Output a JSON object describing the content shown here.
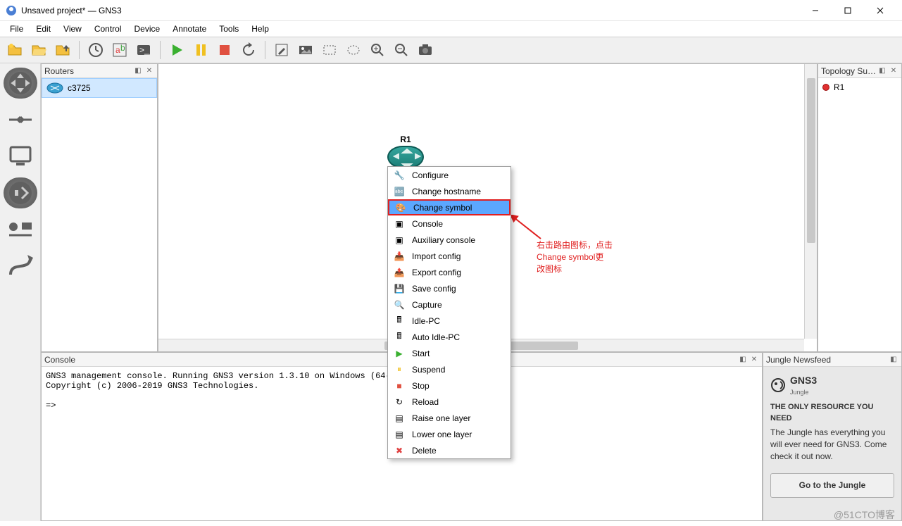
{
  "window": {
    "title": "Unsaved project* — GNS3"
  },
  "menu": [
    "File",
    "Edit",
    "View",
    "Control",
    "Device",
    "Annotate",
    "Tools",
    "Help"
  ],
  "routersPanel": {
    "title": "Routers",
    "items": [
      "c3725"
    ]
  },
  "topologyPanel": {
    "title": "Topology Su…",
    "items": [
      "R1"
    ]
  },
  "canvas": {
    "node_label": "R1"
  },
  "context": {
    "items": [
      "Configure",
      "Change hostname",
      "Change symbol",
      "Console",
      "Auxiliary console",
      "Import config",
      "Export config",
      "Save config",
      "Capture",
      "Idle-PC",
      "Auto Idle-PC",
      "Start",
      "Suspend",
      "Stop",
      "Reload",
      "Raise one layer",
      "Lower one layer",
      "Delete"
    ],
    "highlight_index": 2
  },
  "annotation": {
    "line1": "右击路由图标，点击",
    "line2": "Change symbol更",
    "line3": "改图标"
  },
  "consolePanel": {
    "title": "Console",
    "text": "GNS3 management console. Running GNS3 version 1.3.10 on Windows (64-bit).\nCopyright (c) 2006-2019 GNS3 Technologies.\n\n=>"
  },
  "newsfeed": {
    "title": "Jungle Newsfeed",
    "brand": "GNS3",
    "brand_sub": "Jungle",
    "headline": "THE ONLY RESOURCE YOU NEED",
    "body": "The Jungle has everything you will ever need for GNS3. Come check it out now.",
    "button": "Go to the Jungle"
  },
  "watermark": "@51CTO博客"
}
